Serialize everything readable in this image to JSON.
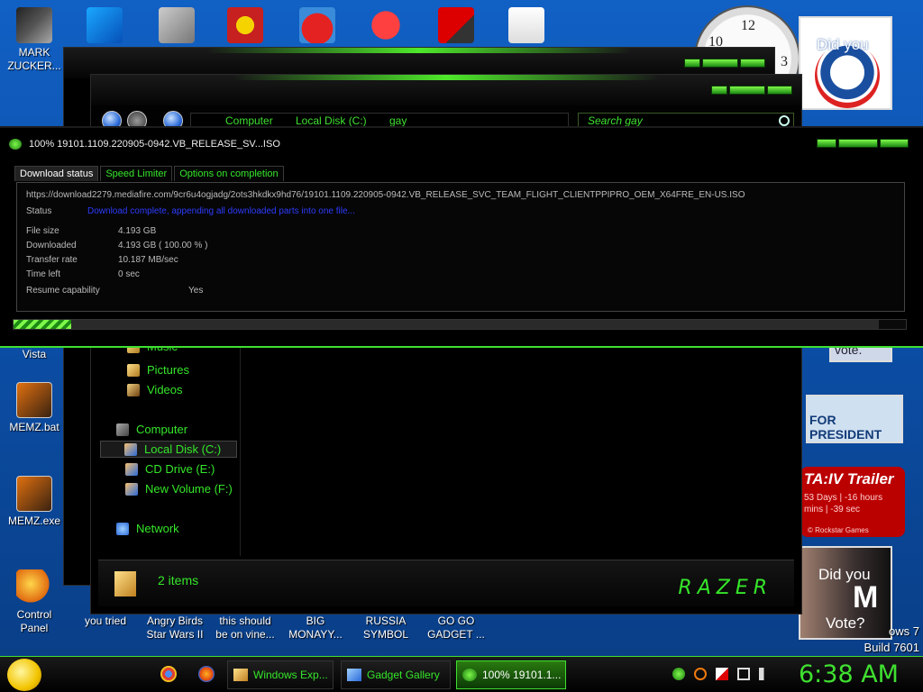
{
  "desktop": {
    "icons": [
      {
        "label": "MARK\nZUCKER...",
        "icon": "mark-zuckerberg-icon"
      },
      {
        "label": "Vista",
        "icon": "vista-icon"
      },
      {
        "label": "MEMZ.bat",
        "icon": "memz-bat-icon"
      },
      {
        "label": "MEMZ.exe",
        "icon": "memz-exe-icon"
      },
      {
        "label": "Control\nPanel",
        "icon": "control-panel-icon"
      },
      {
        "label": "you tried",
        "icon": "you-tried-icon"
      },
      {
        "label": "Angry Birds\nStar Wars II",
        "icon": "angry-birds-icon"
      },
      {
        "label": "this should\nbe on vine...",
        "icon": "vine-icon"
      },
      {
        "label": "BIG\nMONAYY...",
        "icon": "big-money-icon"
      },
      {
        "label": "RUSSIA\nSYMBOL",
        "icon": "russia-symbol-icon"
      },
      {
        "label": "GO GO\nGADGET ...",
        "icon": "gadget-icon"
      }
    ],
    "clock_numbers": [
      "12",
      "10",
      "3"
    ],
    "gadgets": {
      "did_you_1": "Did you",
      "for_president": "FOR PRESIDENT",
      "gta_title": "TA:IV Trailer",
      "gta_countdown": "53 Days | -16 hours\nmins | -39 sec",
      "gta_brand": "© Rockstar Games",
      "did_you_2": "Did you",
      "m_letter": "M",
      "vote": "Vote?",
      "vote_2": "vote."
    },
    "watermark": {
      "line1": "ows 7",
      "line2": "Build 7601"
    }
  },
  "explorer": {
    "address": {
      "crumb1": "Computer",
      "crumb2": "Local Disk (C:)",
      "crumb3": "gay"
    },
    "search_placeholder": "Search gay",
    "nav": {
      "music": "Music",
      "pictures": "Pictures",
      "videos": "Videos",
      "computer": "Computer",
      "local_disk": "Local Disk (C:)",
      "cd_drive": "CD Drive (E:)",
      "new_volume": "New Volume (F:)",
      "network": "Network"
    },
    "status_items": "2 items",
    "brand": "RAZER"
  },
  "download": {
    "title": "100% 19101.1109.220905-0942.VB_RELEASE_SV...ISO",
    "tabs": [
      "Download status",
      "Speed Limiter",
      "Options on completion"
    ],
    "url": "https://download2279.mediafire.com/9cr6u4ogjadg/2ots3hkdkx9hd76/19101.1109.220905-0942.VB_RELEASE_SVC_TEAM_FLIGHT_CLIENTPPIPRO_OEM_X64FRE_EN-US.ISO",
    "status_label": "Status",
    "status_value": "Download complete, appending all downloaded parts into one file...",
    "file_size_label": "File size",
    "file_size_value": "4.193  GB",
    "downloaded_label": "Downloaded",
    "downloaded_value": "4.193  GB  ( 100.00 % )",
    "rate_label": "Transfer rate",
    "rate_value": "10.187  MB/sec",
    "time_left_label": "Time left",
    "time_left_value": "0 sec",
    "resume_label": "Resume capability",
    "resume_value": "Yes",
    "progress_fraction": 1.0
  },
  "taskbar": {
    "buttons": [
      "Windows Exp...",
      "Gadget Gallery",
      "100% 19101.1..."
    ],
    "time": "6:38 AM"
  },
  "colors": {
    "accent": "#3fe030",
    "status_blue": "#2d3bff",
    "background": "#000000"
  }
}
